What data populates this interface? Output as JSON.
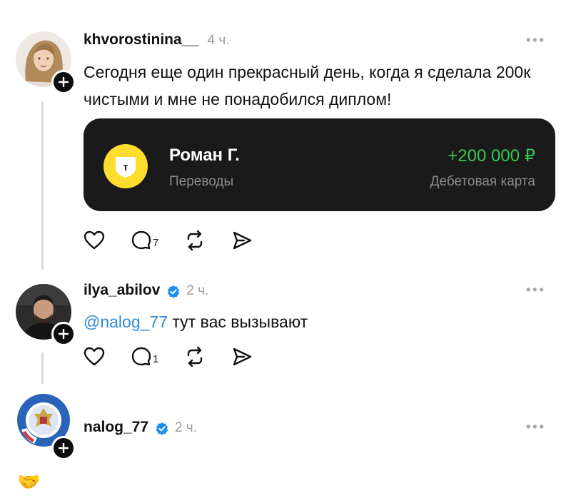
{
  "posts": [
    {
      "username": "khvorostinina__",
      "time": "4 ч.",
      "text": "Сегодня еще один прекрасный день, когда я сделала 200к чистыми и мне не понадобился диплом!",
      "card": {
        "logo_letter": "т",
        "name": "Роман Г.",
        "subtitle": "Переводы",
        "amount": "+200 000 ₽",
        "account_type": "Дебетовая карта"
      },
      "replies_count": "7"
    },
    {
      "username": "ilya_abilov",
      "time": "2 ч.",
      "mention": "@nalog_77",
      "text": "тут вас вызывают",
      "replies_count": "1"
    },
    {
      "username": "nalog_77",
      "time": "2 ч.",
      "emoji": "🤝"
    }
  ],
  "colors": {
    "accent_blue": "#2f8ad6",
    "amount_green": "#38c74e",
    "card_bg": "#1a1a1a",
    "bank_yellow": "#ffdd2d"
  }
}
